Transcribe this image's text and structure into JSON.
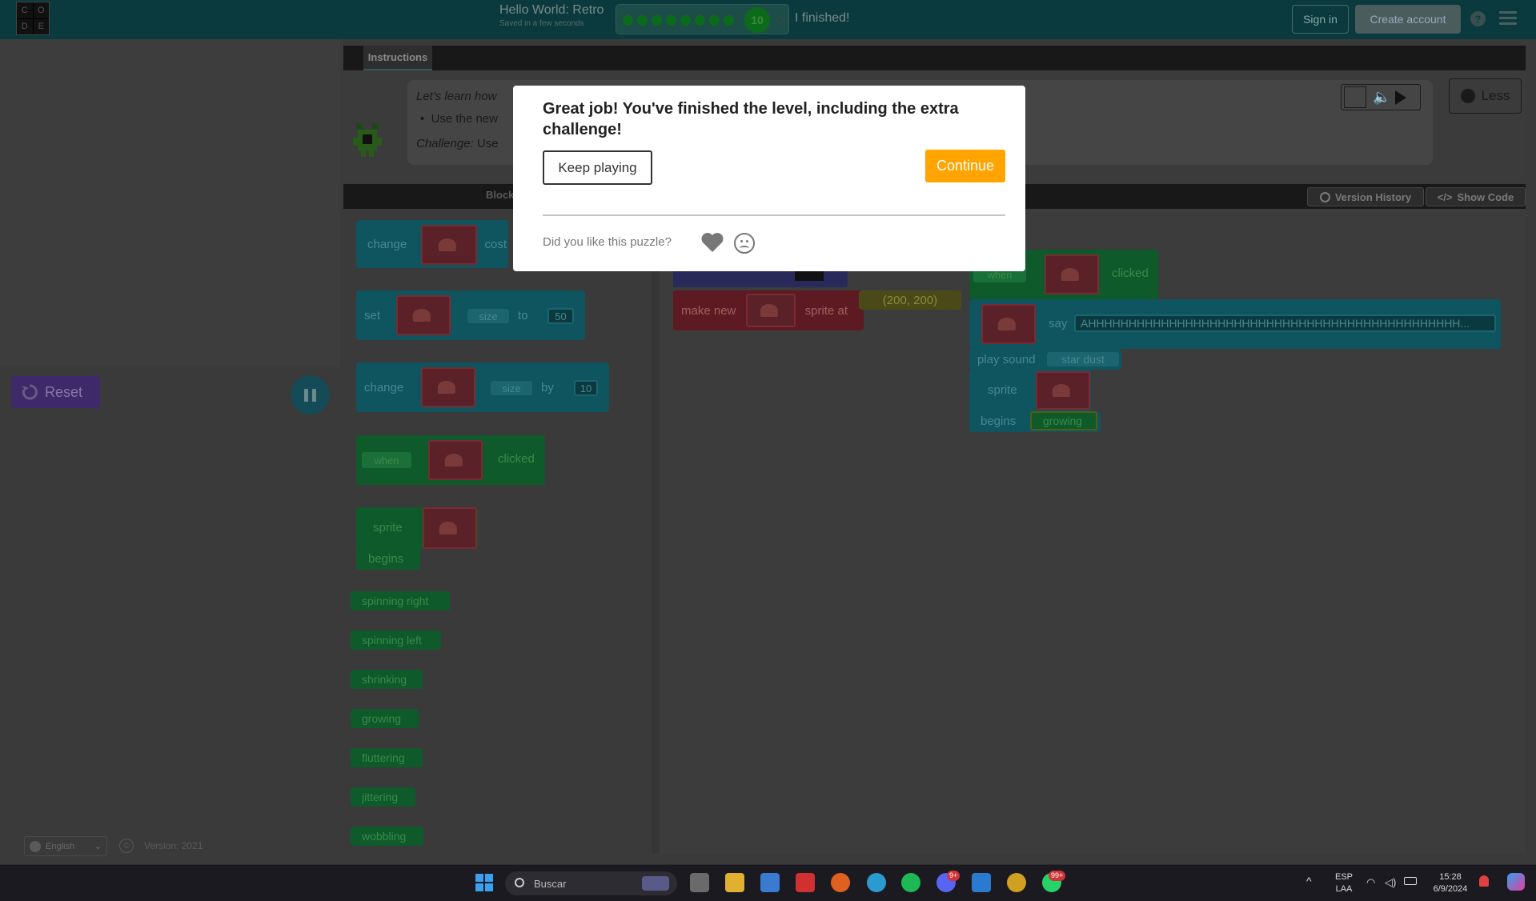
{
  "header": {
    "logo_letters": [
      "C",
      "O",
      "D",
      "E"
    ],
    "title": "Hello World: Retro",
    "saved": "Saved in a few seconds",
    "progress_current": "10",
    "finished_label": "I finished!",
    "sign_in": "Sign in",
    "create_account": "Create account",
    "help": "?"
  },
  "stage": {
    "reset_label": "Reset",
    "language": "English",
    "copyright": "©",
    "version": "Version: 2021"
  },
  "instructions": {
    "tab": "Instructions",
    "line1": "Let's learn how",
    "bullet": "Use the new",
    "challenge_label": "Challenge:",
    "challenge_text": "Use",
    "less_label": "Less"
  },
  "workspace": {
    "blocks_label": "Block",
    "version_history": "Version History",
    "show_code": "Show Code"
  },
  "toolbox": {
    "change_costume": "change",
    "costume_tail": "cost",
    "set": "set",
    "size": "size",
    "to": "to",
    "set_value": "50",
    "change": "change",
    "by": "by",
    "change_value": "10",
    "when": "when",
    "clicked": "clicked",
    "sprite": "sprite",
    "begins": "begins",
    "behaviors": [
      "spinning right",
      "spinning left",
      "shrinking",
      "growing",
      "fluttering",
      "jittering",
      "wobbling"
    ]
  },
  "program": {
    "make_new": "make new",
    "sprite_at": "sprite at",
    "coords": "(200, 200)",
    "when": "when",
    "clicked": "clicked",
    "say": "say",
    "say_text": "AHHHHHHHHHHHHHHHHHHHHHHHHHHHHHHHHHHHHHHHHHHHHHH...",
    "play_sound": "play sound",
    "sound": "star dust",
    "sprite": "sprite",
    "begins": "begins",
    "behavior": "growing"
  },
  "modal": {
    "title": "Great job! You've finished the level, including the extra challenge!",
    "keep_playing": "Keep playing",
    "continue": "Continue",
    "feedback_question": "Did you like this puzzle?"
  },
  "taskbar": {
    "search_placeholder": "Buscar",
    "lang_top": "ESP",
    "lang_bottom": "LAA",
    "time": "15:28",
    "date": "6/9/2024",
    "discord_badge": "9+",
    "whatsapp_badge": "99+"
  },
  "colors": {
    "continue_button": "#ffa400",
    "header_bg": "#0a3a3d",
    "overlay": "#3a3a3a"
  }
}
